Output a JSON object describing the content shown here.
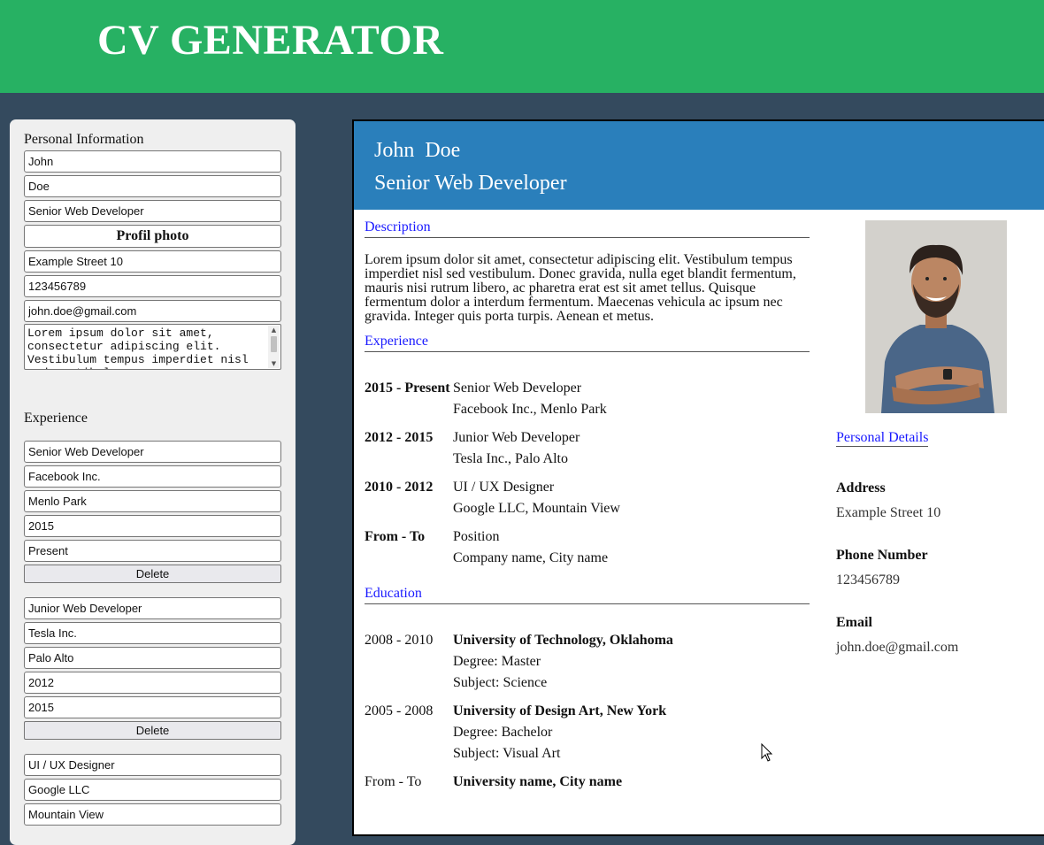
{
  "app": {
    "title": "CV GENERATOR"
  },
  "form": {
    "personal": {
      "heading": "Personal Information",
      "first_name": "John",
      "last_name": "Doe",
      "job_title": "Senior Web Developer",
      "photo_button": "Profil photo",
      "address": "Example Street 10",
      "phone": "123456789",
      "email": "john.doe@gmail.com",
      "description": "Lorem ipsum dolor sit amet, consectetur adipiscing elit. Vestibulum tempus imperdiet nisl sed vestibulum."
    },
    "experience": {
      "heading": "Experience",
      "delete_label": "Delete",
      "items": [
        {
          "position": "Senior Web Developer",
          "company": "Facebook Inc.",
          "city": "Menlo Park",
          "from": "2015",
          "to": "Present"
        },
        {
          "position": "Junior Web Developer",
          "company": "Tesla Inc.",
          "city": "Palo Alto",
          "from": "2012",
          "to": "2015"
        },
        {
          "position": "UI / UX Designer",
          "company": "Google LLC",
          "city": "Mountain View"
        }
      ]
    }
  },
  "cv": {
    "first_name": "John",
    "last_name": "Doe",
    "job_title": "Senior Web Developer",
    "description_heading": "Description",
    "description": "Lorem ipsum dolor sit amet, consectetur adipiscing elit. Vestibulum tempus imperdiet nisl sed vestibulum. Donec gravida, nulla eget blandit fermentum, mauris nisi rutrum libero, ac pharetra erat est sit amet tellus. Quisque fermentum dolor a interdum fermentum. Maecenas vehicula ac ipsum nec gravida. Integer quis porta turpis. Aenean et metus.",
    "experience_heading": "Experience",
    "experience": [
      {
        "dates": "2015 - Present",
        "position": "Senior Web Developer",
        "company": "Facebook Inc., Menlo Park"
      },
      {
        "dates": "2012 - 2015",
        "position": "Junior Web Developer",
        "company": "Tesla Inc., Palo Alto"
      },
      {
        "dates": "2010 - 2012",
        "position": "UI / UX Designer",
        "company": "Google LLC, Mountain View"
      },
      {
        "dates": "From - To",
        "position": "Position",
        "company": "Company name, City name"
      }
    ],
    "education_heading": "Education",
    "education": [
      {
        "dates": "2008 - 2010",
        "university": "University of Technology, Oklahoma",
        "degree": "Degree: Master",
        "subject": "Subject: Science"
      },
      {
        "dates": "2005 - 2008",
        "university": "University of Design Art, New York",
        "degree": "Degree: Bachelor",
        "subject": "Subject: Visual Art"
      },
      {
        "dates": "From - To",
        "university": "University name, City name"
      }
    ],
    "personal_details_heading": "Personal Details",
    "address_label": "Address",
    "address": "Example Street 10",
    "phone_label": "Phone Number",
    "phone": "123456789",
    "email_label": "Email",
    "email": "john.doe@gmail.com"
  },
  "colors": {
    "header_green": "#27b163",
    "page_bg": "#344a5e",
    "cv_header_blue": "#2a7fbb",
    "section_link": "#1a1aff"
  },
  "icons": {
    "cursor": "mouse-pointer-icon"
  }
}
